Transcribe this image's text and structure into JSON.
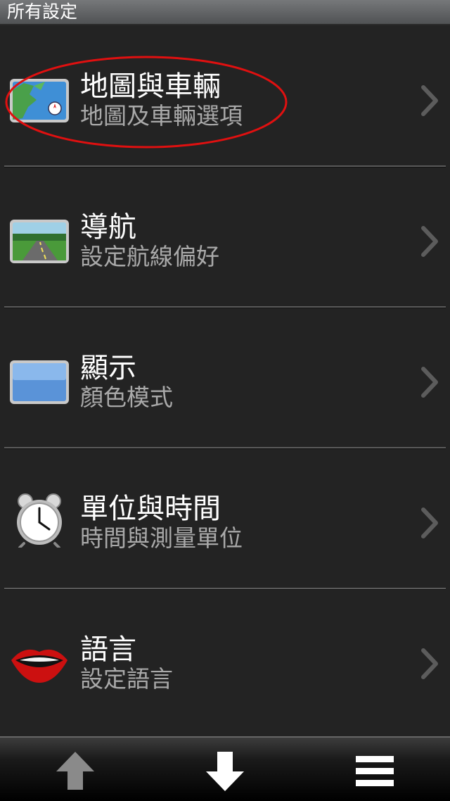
{
  "titlebar": {
    "title": "所有設定"
  },
  "items": [
    {
      "title": "地圖與車輛",
      "subtitle": "地圖及車輛選項",
      "icon": "map-icon"
    },
    {
      "title": "導航",
      "subtitle": "設定航線偏好",
      "icon": "road-icon"
    },
    {
      "title": "顯示",
      "subtitle": "顏色模式",
      "icon": "display-icon"
    },
    {
      "title": "單位與時間",
      "subtitle": "時間與測量單位",
      "icon": "alarm-clock-icon"
    },
    {
      "title": "語言",
      "subtitle": "設定語言",
      "icon": "lips-icon"
    }
  ],
  "bottombar": {
    "buttons": [
      "scroll-up-arrow-icon",
      "scroll-down-arrow-icon",
      "menu-icon"
    ]
  },
  "colors": {
    "background": "#232323",
    "title_text": "#ffffff",
    "subtitle_text": "#a9a9a9",
    "highlight_ellipse": "#e01010"
  }
}
